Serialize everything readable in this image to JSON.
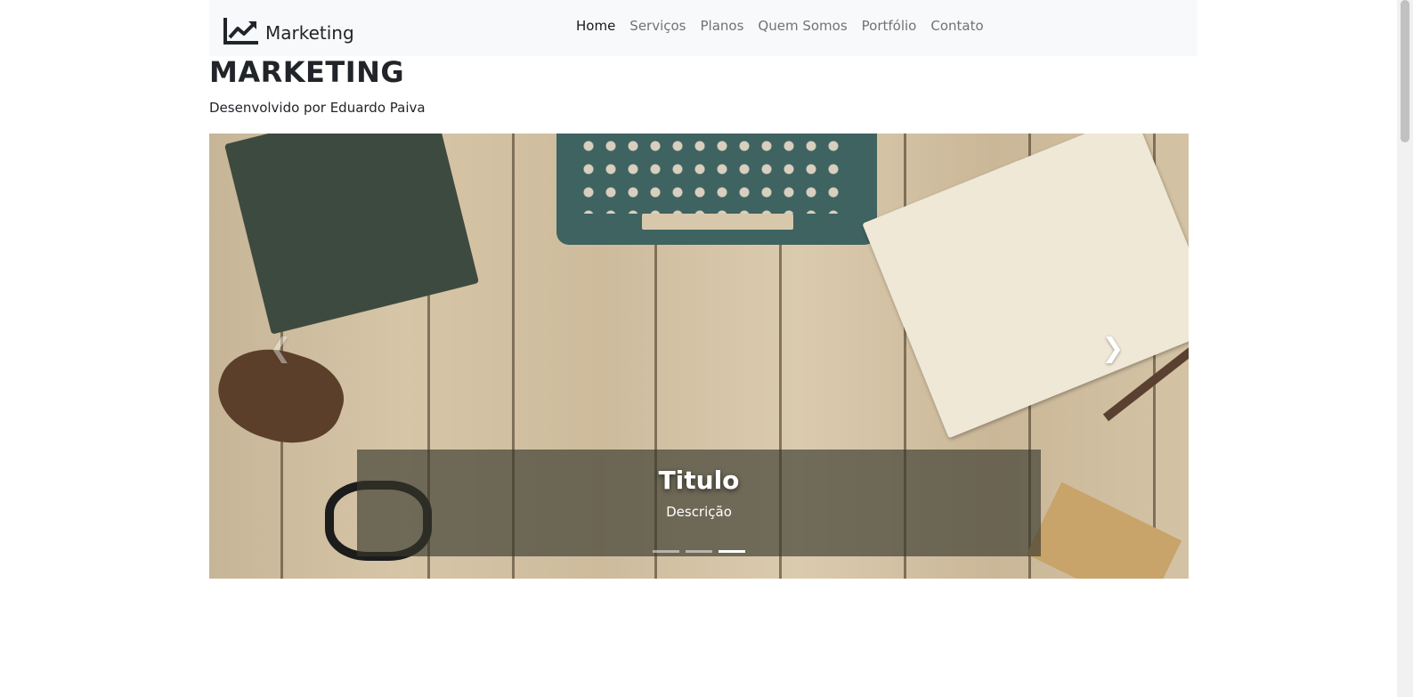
{
  "navbar": {
    "brand": {
      "icon": "chart-line-icon",
      "label": "Marketing"
    },
    "items": [
      {
        "label": "Home",
        "active": true
      },
      {
        "label": "Serviços",
        "active": false
      },
      {
        "label": "Planos",
        "active": false
      },
      {
        "label": "Quem Somos",
        "active": false
      },
      {
        "label": "Portfólio",
        "active": false
      },
      {
        "label": "Contato",
        "active": false
      }
    ]
  },
  "header": {
    "title": "MARKETING",
    "subtitle": "Desenvolvido por Eduardo Paiva"
  },
  "carousel": {
    "image": "desk-with-typewriter-photo",
    "caption": {
      "title": "Titulo",
      "description": "Descrição"
    },
    "slide_count": 3,
    "active_index": 2,
    "prev_icon": "chevron-left-icon",
    "next_icon": "chevron-right-icon"
  }
}
